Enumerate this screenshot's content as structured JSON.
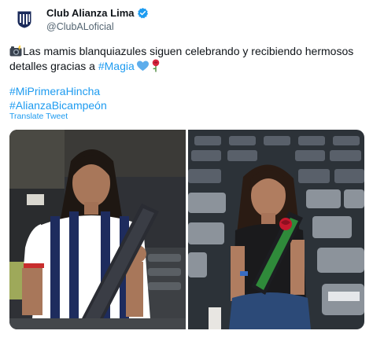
{
  "account": {
    "display_name": "Club Alianza Lima",
    "handle": "@ClubALoficial",
    "verified": true,
    "avatar_icon": "alianza-lima-crest-icon",
    "verified_icon": "verified-badge-icon",
    "verified_color": "#1d9bf0"
  },
  "tweet": {
    "line1": "Las mamis blanquiazules siguen celebrando y recibiendo hermosos",
    "line2_prefix": "detalles gracias a ",
    "line2_mention": "#Magia",
    "emojis": [
      "camera-flash-emoji",
      "blue-heart-emoji",
      "rose-emoji"
    ],
    "hashtags": [
      "#MiPrimeraHincha",
      "#AlianzaBicampeón"
    ],
    "translate_label": "Translate Tweet"
  },
  "media": {
    "photos": [
      {
        "name": "woman-in-striped-jersey-holding-gift-box"
      },
      {
        "name": "woman-in-stadium-seats-holding-rose-box"
      }
    ]
  },
  "colors": {
    "link": "#1d9bf0",
    "text": "#0f1419",
    "secondary_text": "#536471"
  }
}
